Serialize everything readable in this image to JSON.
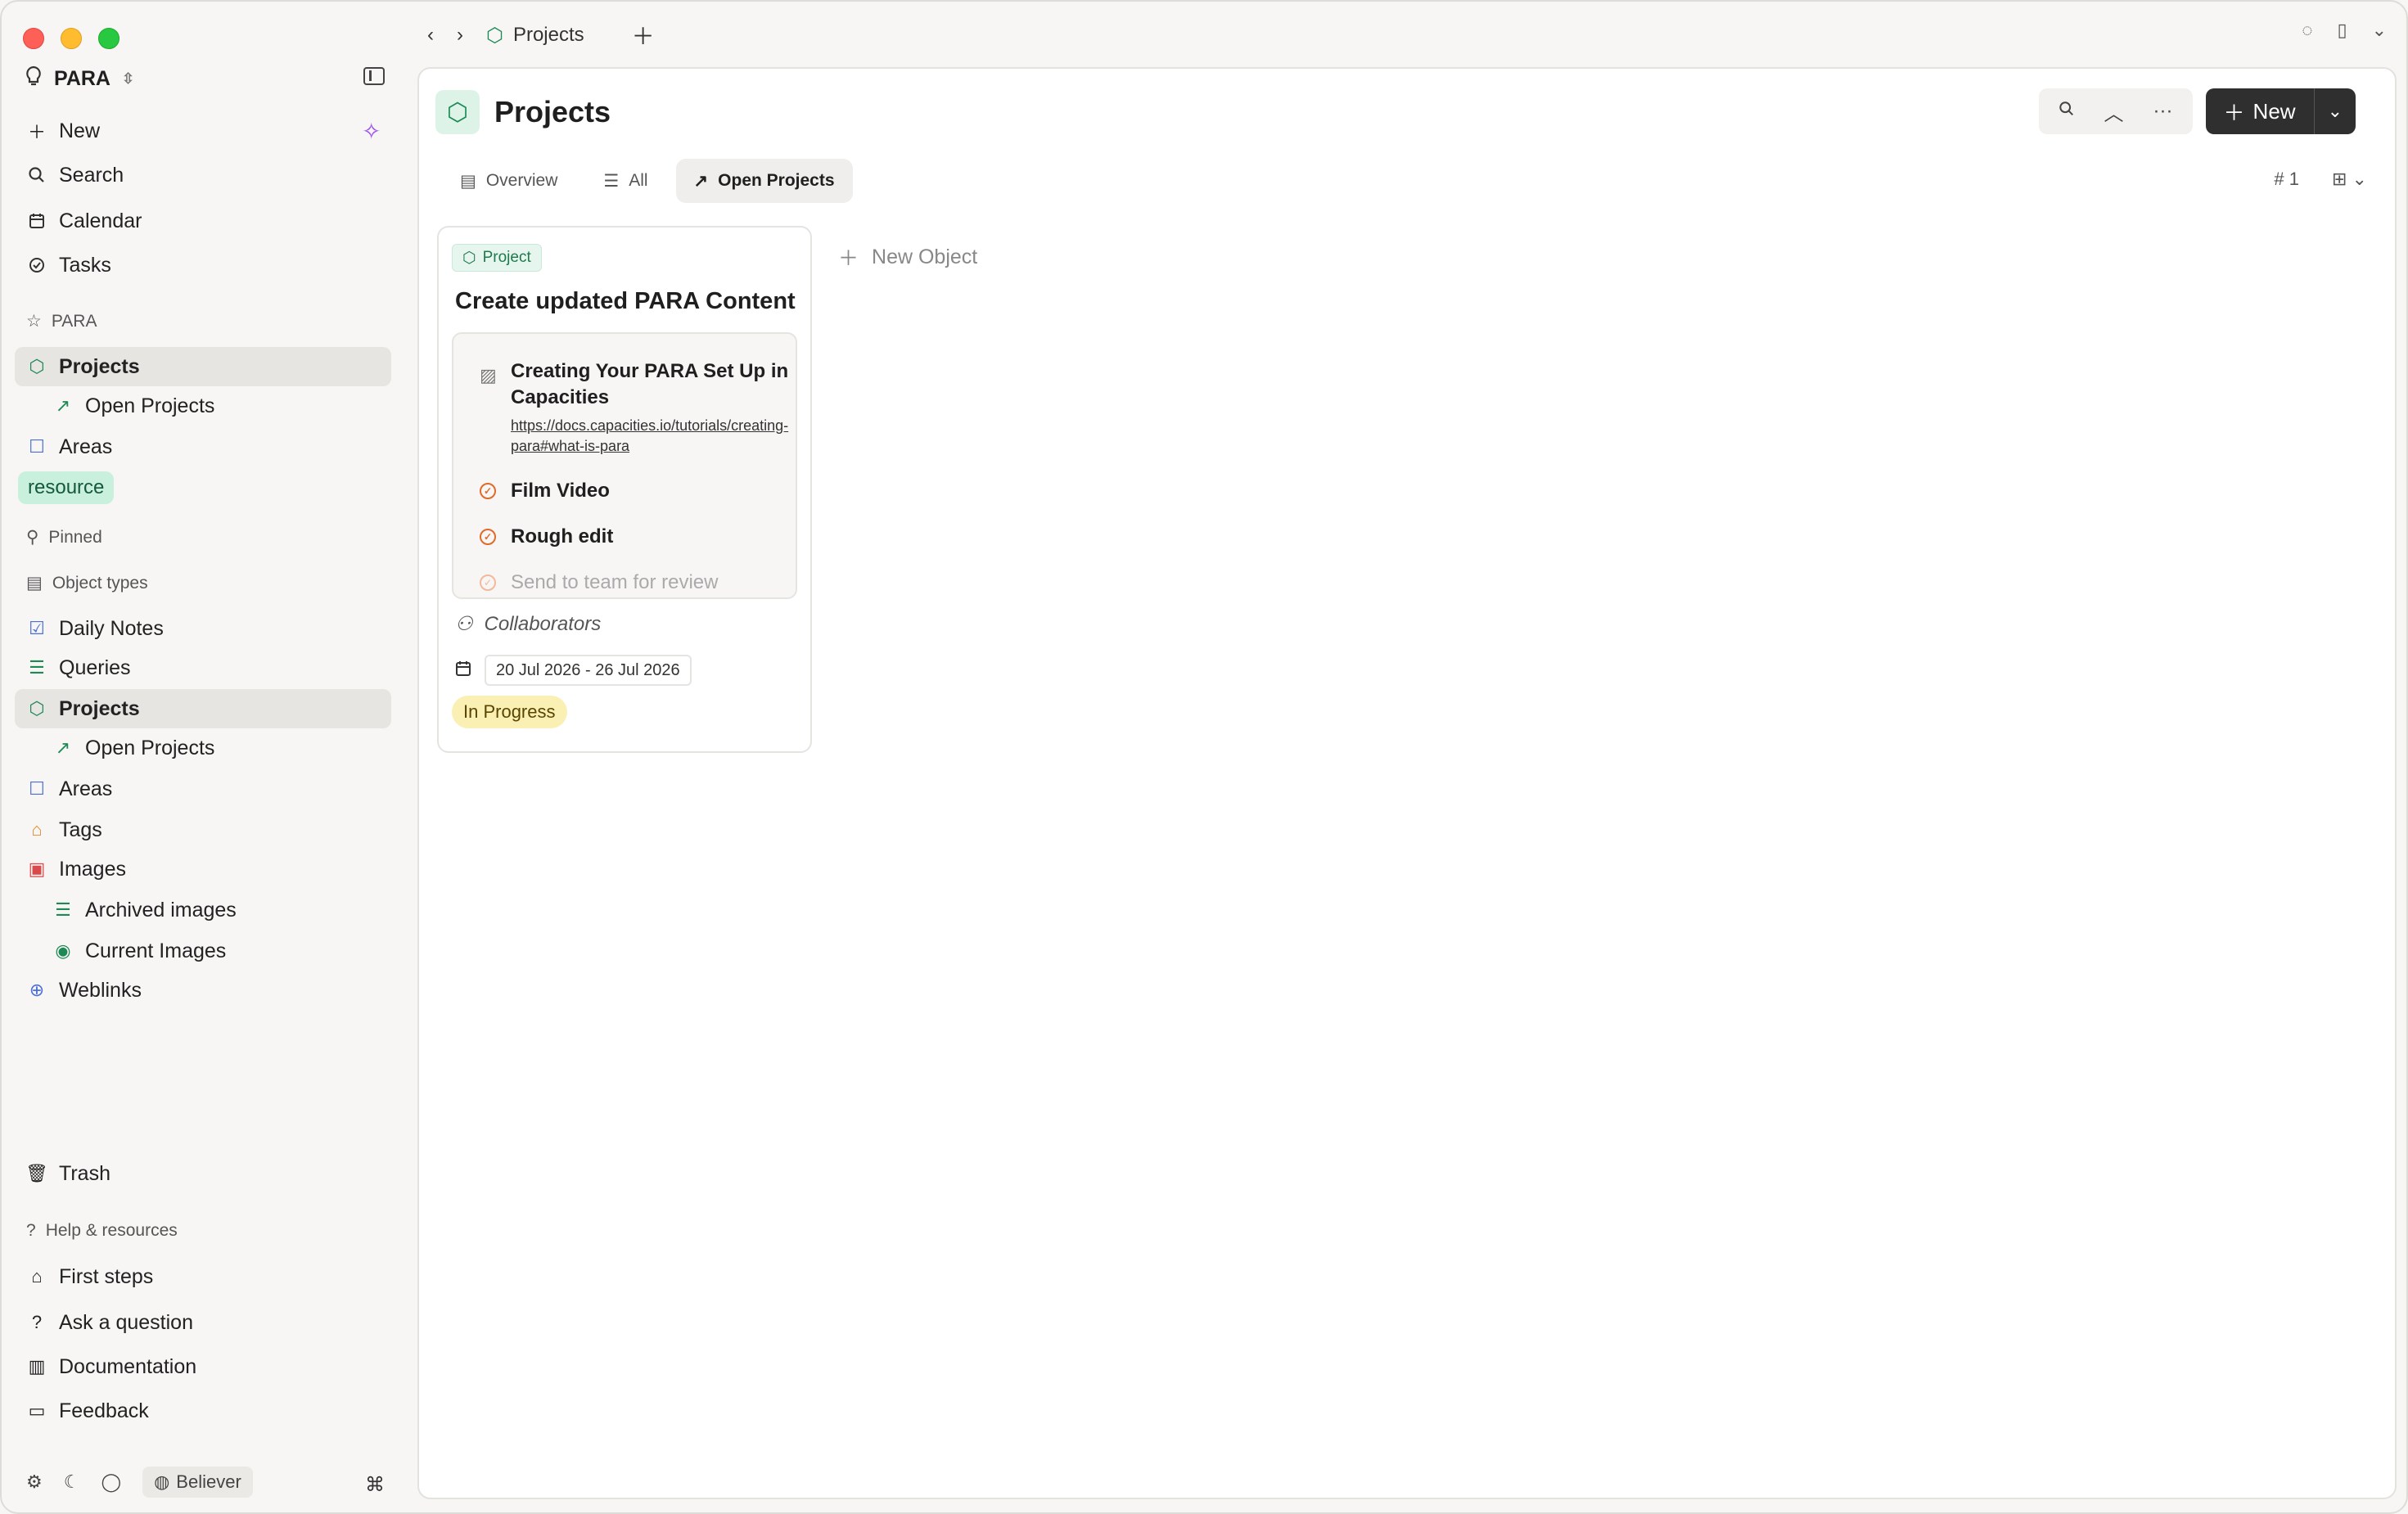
{
  "workspace": {
    "name": "PARA"
  },
  "sidebar": {
    "top": [
      {
        "label": "New",
        "icon": "plus-icon"
      },
      {
        "label": "Search",
        "icon": "search-icon"
      },
      {
        "label": "Calendar",
        "icon": "calendar-icon"
      },
      {
        "label": "Tasks",
        "icon": "check-circle-icon"
      }
    ],
    "para_section": "PARA",
    "para_items": [
      {
        "label": "Projects",
        "icon": "cube-icon"
      },
      {
        "label": "Open Projects",
        "icon": "trending-icon"
      },
      {
        "label": "Areas",
        "icon": "square-icon"
      }
    ],
    "resource_chip": "resource",
    "pinned_section": "Pinned",
    "object_types_section": "Object types",
    "object_types": [
      {
        "label": "Daily Notes"
      },
      {
        "label": "Queries"
      },
      {
        "label": "Projects"
      },
      {
        "label": "Open Projects"
      },
      {
        "label": "Areas"
      },
      {
        "label": "Tags"
      },
      {
        "label": "Images"
      },
      {
        "label": "Archived images"
      },
      {
        "label": "Current Images"
      },
      {
        "label": "Weblinks"
      }
    ],
    "trash": "Trash",
    "help_section": "Help & resources",
    "help_items": [
      {
        "label": "First steps"
      },
      {
        "label": "Ask a question"
      },
      {
        "label": "Documentation"
      },
      {
        "label": "Feedback"
      }
    ],
    "plan_badge": "Believer",
    "shortcut": "⌘"
  },
  "topbar": {
    "breadcrumb": "Projects"
  },
  "page": {
    "title": "Projects",
    "new_button": "New",
    "tabs": [
      {
        "label": "Overview"
      },
      {
        "label": "All"
      },
      {
        "label": "Open Projects"
      }
    ],
    "count": "1",
    "new_object": "New Object"
  },
  "card": {
    "type_chip": "Project",
    "title": "Create updated PARA Content",
    "link_title": "Creating Your PARA Set Up in Capacities",
    "link_url": "https://docs.capacities.io/tutorials/creating-para#what-is-para",
    "tasks": [
      "Film Video",
      "Rough edit",
      "Send to team for review"
    ],
    "collaborators": "Collaborators",
    "date_range": "20 Jul 2026 - 26 Jul 2026",
    "status": "In Progress"
  },
  "colors": {
    "accent_green": "#1d8a55",
    "new_button_bg": "#2f2f2f",
    "status_yellow": "#fbf0b4",
    "resource_chip": "#c9f0dd"
  }
}
